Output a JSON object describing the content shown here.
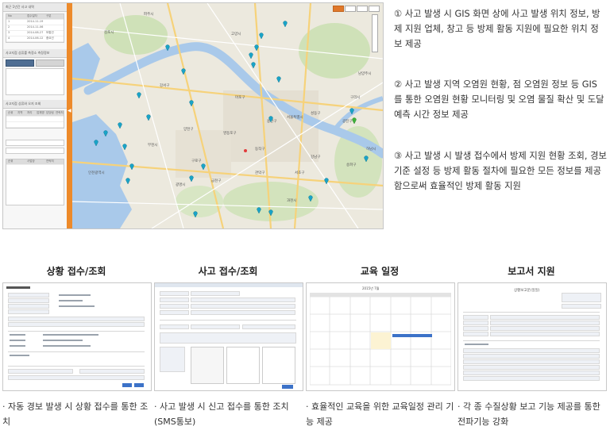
{
  "gis": {
    "panel_title": "최근 1년간 사고 내역",
    "panel_headers": [
      "No",
      "접수일자",
      "구분"
    ],
    "panel_rows": [
      [
        "1",
        "2014-11-19",
        ""
      ],
      [
        "2",
        "2014-11-06",
        ""
      ],
      [
        "3",
        "2014-08-27",
        "보통건"
      ],
      [
        "4",
        "2014-06-12",
        "중요건"
      ]
    ],
    "panel_section2": "사고지점 상류를 측정소 측정정보",
    "panel_section3": "사고지점 상류와 오지 조회",
    "panel_section3_headers": [
      "순위",
      "지역",
      "처리",
      "업체명",
      "담당팀",
      "연락처"
    ],
    "panel_section4_headers": [
      "순위",
      "사업장",
      "연락처"
    ],
    "map_labels": [
      "김포시",
      "고양시",
      "파주시",
      "서울특별시",
      "강서구",
      "마포구",
      "영등포구",
      "용산구",
      "성동구",
      "광진구",
      "강남구",
      "송파구",
      "서초구",
      "구로구",
      "금천구",
      "관악구",
      "동작구",
      "양천구",
      "인천광역시",
      "부천시",
      "광명시",
      "하남시",
      "남양주시",
      "구리시",
      "과천시"
    ],
    "pin_color": "#19a4c8",
    "accent_color": "#ed8a2a",
    "river_color": "#a9c9ea"
  },
  "description": [
    "① 사고 발생 시 GIS 화면 상에 사고 발생 위치 정보, 방제 지원 업체, 창고 등 방제 활동 지원에 필요한 위치 정보 제공",
    "② 사고 발생 지역 오염원 현황, 점 오염원 정보 등 GIS 를 통한 오염원 현황 모니터링 및 오염 물질 확산 및 도달 예측 시간 정보 제공",
    "③ 사고 발생 시 발생 접수에서 방제 지원 현황 조회, 경보 기준 설정 등 방제 활동 절차에 필요한 모든 정보를 제공함으로써 효율적인 방제 활동 지원"
  ],
  "cards": [
    {
      "title": "상황 접수/조회",
      "caption": "· 자동 경보 발생 시 상황 접수를 통한 조치"
    },
    {
      "title": "사고 접수/조회",
      "caption": "· 사고 발생 시  신고 접수를 통한 조치 (SMS통보)"
    },
    {
      "title": "교육 일정",
      "caption": "· 효율적인 교육을 위한 교육일정 관리 기능 제공"
    },
    {
      "title": "보고서 지원",
      "caption": "· 각 종 수질상황 보고 기능 제공를 통한 전파기능 강화"
    }
  ],
  "report_doc_title": "상황보고문(일일)",
  "calendar_month": "2015년 7월"
}
